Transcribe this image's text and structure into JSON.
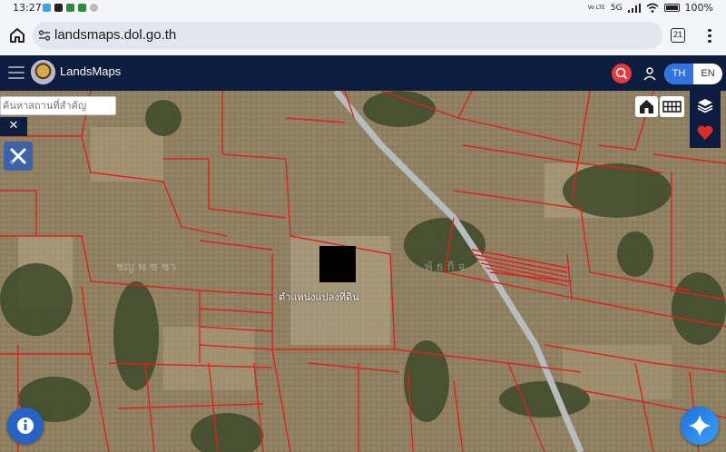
{
  "status_bar": {
    "time": "13:27",
    "network": "Vo LTE",
    "signal": "5G",
    "battery": "100%"
  },
  "browser": {
    "url": "landsmaps.dol.go.th",
    "tab_count": "21"
  },
  "app": {
    "brand": "LandsMaps",
    "lang_active": "TH",
    "lang_inactive": "EN"
  },
  "map": {
    "search_placeholder": "ค้นหาสถานที่สำคัญ",
    "parcel_label": "ตำแหน่งแปลงที่ดิน",
    "watermark_left": "ชญ  พ  ช ชา",
    "watermark_right": "พั  ธ  กิ  จ",
    "close_symbol": "✕"
  },
  "colors": {
    "header": "#0c1d3f",
    "accent": "#2f74df",
    "parcel_line": "#e0201e"
  }
}
